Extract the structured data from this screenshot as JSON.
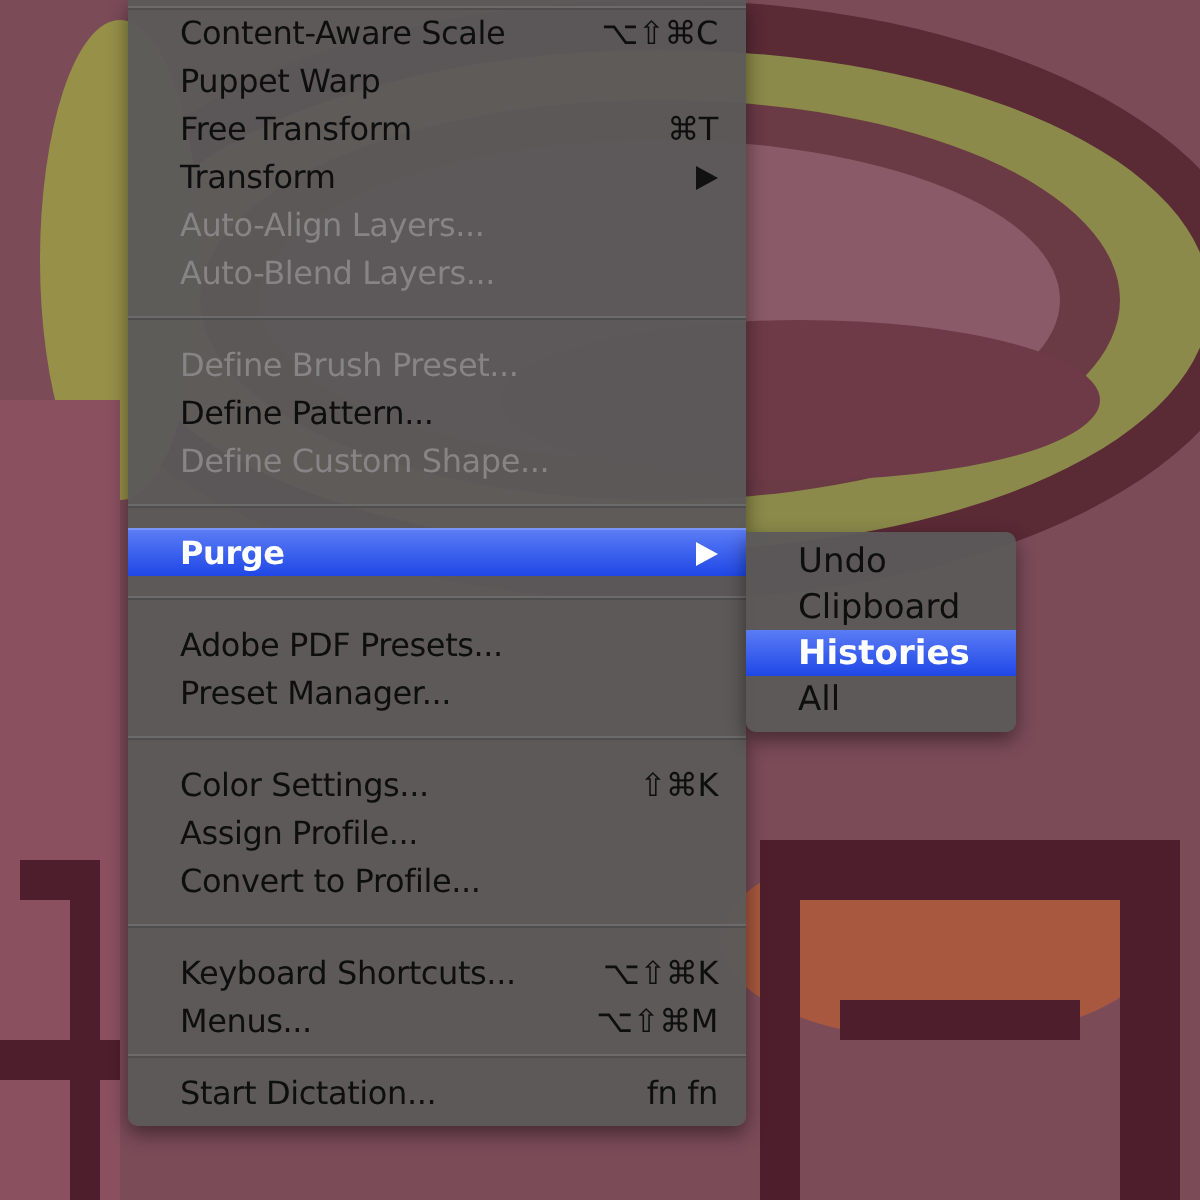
{
  "menu": {
    "groups": [
      {
        "items": [
          {
            "label": "Content-Aware Scale",
            "shortcut": "⌥⇧⌘C",
            "disabled": false,
            "selected": false
          },
          {
            "label": "Puppet Warp",
            "disabled": false,
            "selected": false
          },
          {
            "label": "Free Transform",
            "shortcut": "⌘T",
            "disabled": false,
            "selected": false
          },
          {
            "label": "Transform",
            "submenu": true,
            "disabled": false,
            "selected": false
          },
          {
            "label": "Auto-Align Layers...",
            "disabled": true,
            "selected": false
          },
          {
            "label": "Auto-Blend Layers...",
            "disabled": true,
            "selected": false
          }
        ]
      },
      {
        "items": [
          {
            "label": "Define Brush Preset...",
            "disabled": true,
            "selected": false
          },
          {
            "label": "Define Pattern...",
            "disabled": false,
            "selected": false
          },
          {
            "label": "Define Custom Shape...",
            "disabled": true,
            "selected": false
          }
        ]
      },
      {
        "items": [
          {
            "label": "Purge",
            "submenu": true,
            "disabled": false,
            "selected": true
          }
        ]
      },
      {
        "items": [
          {
            "label": "Adobe PDF Presets...",
            "disabled": false,
            "selected": false
          },
          {
            "label": "Preset Manager...",
            "disabled": false,
            "selected": false
          }
        ]
      },
      {
        "items": [
          {
            "label": "Color Settings...",
            "shortcut": "⇧⌘K",
            "disabled": false,
            "selected": false
          },
          {
            "label": "Assign Profile...",
            "disabled": false,
            "selected": false
          },
          {
            "label": "Convert to Profile...",
            "disabled": false,
            "selected": false
          }
        ]
      },
      {
        "items": [
          {
            "label": "Keyboard Shortcuts...",
            "shortcut": "⌥⇧⌘K",
            "disabled": false,
            "selected": false
          },
          {
            "label": "Menus...",
            "shortcut": "⌥⇧⌘M",
            "disabled": false,
            "selected": false
          }
        ]
      },
      {
        "items": [
          {
            "label": "Start Dictation...",
            "shortcut": "fn fn",
            "disabled": false,
            "selected": false
          }
        ]
      }
    ]
  },
  "submenu": {
    "items": [
      {
        "label": "Undo",
        "selected": false
      },
      {
        "label": "Clipboard",
        "selected": false
      },
      {
        "label": "Histories",
        "selected": true
      },
      {
        "label": "All",
        "selected": false
      }
    ]
  }
}
